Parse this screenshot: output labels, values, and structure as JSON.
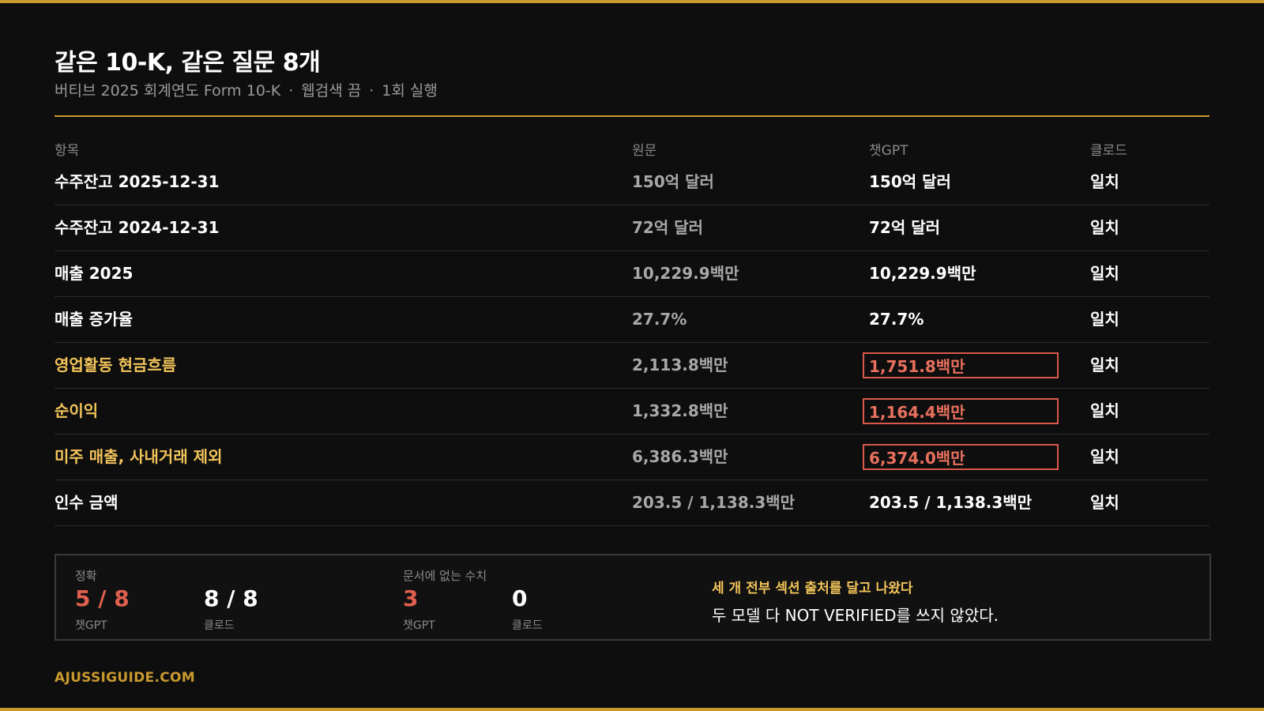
{
  "header": {
    "title": "같은 10-K, 같은 질문 8개",
    "subtitle_parts": [
      "버티브 2025 회계연도 Form 10-K",
      "웹검색 끔",
      "1회 실행"
    ],
    "separator": "·"
  },
  "table": {
    "columns": [
      "항목",
      "원문",
      "챗GPT",
      "클로드"
    ],
    "rows": [
      {
        "item": "수주잔고  2025-12-31",
        "original": "150억 달러",
        "chatgpt": "150억 달러",
        "claude": "일치"
      },
      {
        "item": "수주잔고  2024-12-31",
        "original": "72억 달러",
        "chatgpt": "72억 달러",
        "claude": "일치"
      },
      {
        "item": "매출  2025",
        "original": "10,229.9백만",
        "chatgpt": "10,229.9백만",
        "claude": "일치"
      },
      {
        "item": "매출 증가율",
        "original": "27.7%",
        "chatgpt": "27.7%",
        "claude": "일치"
      },
      {
        "item": "영업활동 현금흐름",
        "original": "2,113.8백만",
        "chatgpt": "1,751.8백만",
        "claude": "일치"
      },
      {
        "item": "순이익",
        "original": "1,332.8백만",
        "chatgpt": "1,164.4백만",
        "claude": "일치"
      },
      {
        "item": "미주 매출, 사내거래 제외",
        "original": "6,386.3백만",
        "chatgpt": "6,374.0백만",
        "claude": "일치"
      },
      {
        "item": "인수 금액",
        "original": "203.5 / 1,138.3백만",
        "chatgpt": "203.5 / 1,138.3백만",
        "claude": "일치"
      }
    ]
  },
  "summary": {
    "accuracy": {
      "label": "정확",
      "chatgpt_value": "5 / 8",
      "chatgpt_caption": "챗GPT",
      "claude_value": "8 / 8",
      "claude_caption": "클로드"
    },
    "unsupported": {
      "label": "문서에 없는 수치",
      "chatgpt_value": "3",
      "chatgpt_caption": "챗GPT",
      "claude_value": "0",
      "claude_caption": "클로드"
    },
    "note_highlight": "세 개 전부 섹션 출처를 달고 나왔다",
    "note": "두 모델 다 NOT VERIFIED를 쓰지 않았다."
  },
  "footer": {
    "site": "AJUSSIGUIDE.COM"
  },
  "colors": {
    "accent_gold": "#c99a2e",
    "highlight_yellow": "#f2c45a",
    "error_red": "#e0604f",
    "background": "#0e0e0e"
  }
}
